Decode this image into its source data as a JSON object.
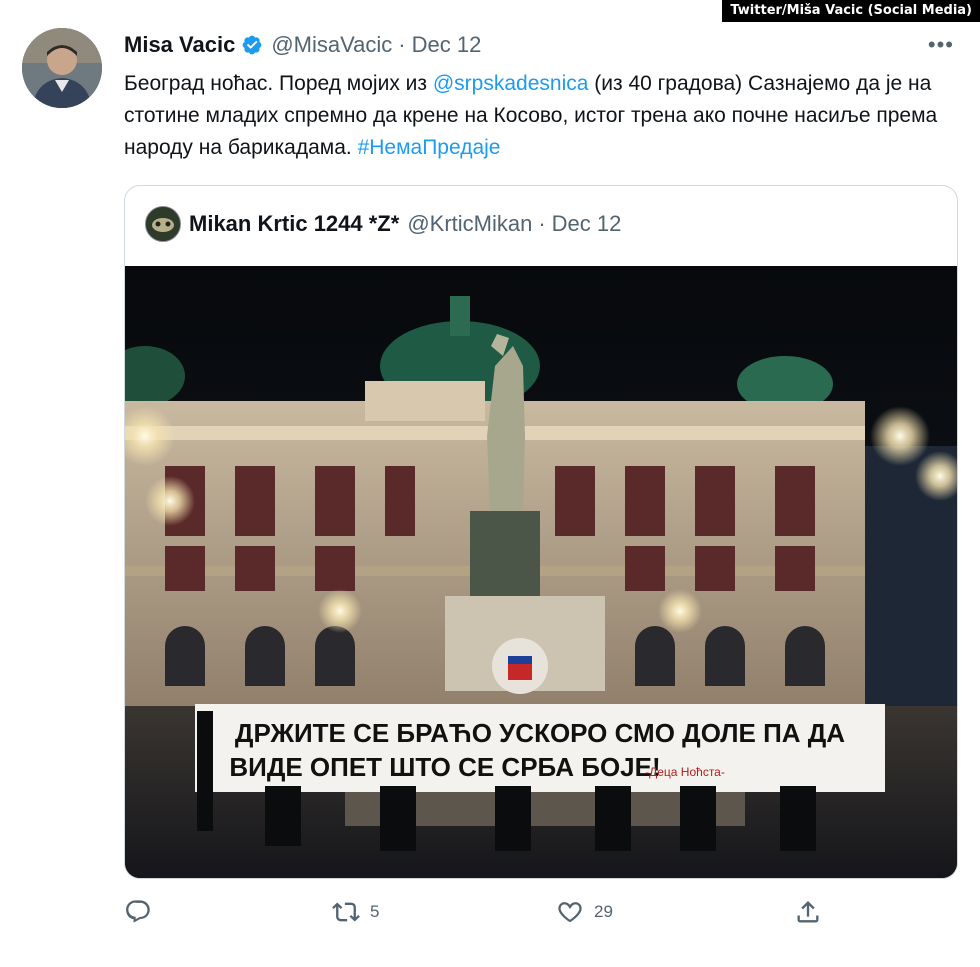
{
  "watermark": "Twitter/Miša Vacic (Social Media)",
  "tweet": {
    "name": "Misa Vacic",
    "handle": "@MisaVacic",
    "separator": "·",
    "date": "Dec 12",
    "text_part1": "Београд ноћас. Поред мојих из ",
    "mention": "@srpskadesnica",
    "text_part2": " (из 40 градова) Сазнајемо да је на стотине младих спремно да крене на Косово, истог трена ако почне насиље према народу на барикадама. ",
    "hashtag": "#НемаПредаје",
    "more_label": "•••"
  },
  "quoted": {
    "name": "Mikan Krtic 1244 *Z*",
    "handle": "@KrticMikan",
    "separator": "·",
    "date": "Dec 12",
    "banner_line1": "ДРЖИТЕ СЕ БРАЋО УСКОРО СМО ДОЛЕ ПА ДА",
    "banner_line2": "ВИДЕ ОПЕТ ШТО СЕ СРБА БОЈЕ!",
    "banner_signature": "-Деца Ноћста-"
  },
  "actions": {
    "reply_count": "",
    "retweet_count": "5",
    "like_count": "29"
  },
  "icons": [
    "verified-badge-icon",
    "more-icon",
    "reply-icon",
    "retweet-icon",
    "like-icon",
    "share-icon"
  ],
  "colors": {
    "accent": "#1d9bf0",
    "muted": "#536471",
    "text": "#0f1419",
    "border": "#cfd9de"
  }
}
